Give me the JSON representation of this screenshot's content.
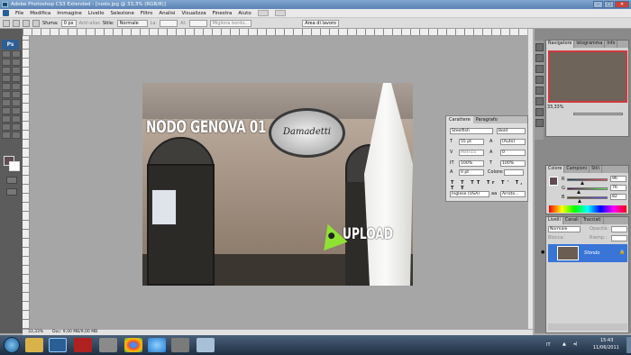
{
  "window": {
    "title": "Adobe Photoshop CS3 Extended - [nodo.jpg @ 33,3% (RGB/8)]"
  },
  "menu": [
    "File",
    "Modifica",
    "Immagine",
    "Livello",
    "Selezione",
    "Filtro",
    "Analisi",
    "Visualizza",
    "Finestra",
    "Aiuto"
  ],
  "options": {
    "sfumato_label": "Sfuma:",
    "sfumato_value": "0 px",
    "antialias": "Anti-alias",
    "stile_label": "Stile:",
    "stile_value": "Normale",
    "la_label": "La:",
    "al_label": "Al:",
    "refine": "Migliora bordo...",
    "workspace": "Area di lavoro"
  },
  "photo": {
    "title_text": "NODO GENOVA 01",
    "sign_text": "Damadetti",
    "upload_text": "UPLOAD"
  },
  "status": {
    "zoom": "33,33%",
    "doc": "Doc: 9,00 MB/9,00 MB"
  },
  "character": {
    "tab1": "Carattere",
    "tab2": "Paragrafo",
    "font": "Steelfish",
    "style": "Bold",
    "size": "55 pt",
    "leading": "(Auto)",
    "kerning": "Metrica",
    "tracking": "0",
    "vscale": "100%",
    "hscale": "100%",
    "baseline": "0 pt",
    "color_label": "Colore:",
    "language": "Inglese (USA)",
    "aa": "Arroto..."
  },
  "navigator": {
    "tab1": "Navigatore",
    "tab2": "Istogramma",
    "tab3": "Info",
    "zoom": "33,33%"
  },
  "color": {
    "tab1": "Colore",
    "tab2": "Campioni",
    "tab3": "Stili",
    "r_label": "R",
    "g_label": "G",
    "b_label": "B",
    "r": "96",
    "g": "76",
    "b": "82",
    "r_level": 0.376,
    "g_level": 0.298,
    "b_level": 0.322
  },
  "layers": {
    "tab1": "Livelli",
    "tab2": "Canali",
    "tab3": "Tracciati",
    "mode": "Normale",
    "opacity_label": "Opacità:",
    "fill_label": "Riemp.:",
    "lock_label": "Blocca:",
    "layer_name": "Sfondo"
  },
  "tray": {
    "lang": "IT",
    "time": "15:43",
    "date": "11/06/2011"
  },
  "colors": {
    "fg": "#604c52",
    "accent": "#8fe234"
  }
}
